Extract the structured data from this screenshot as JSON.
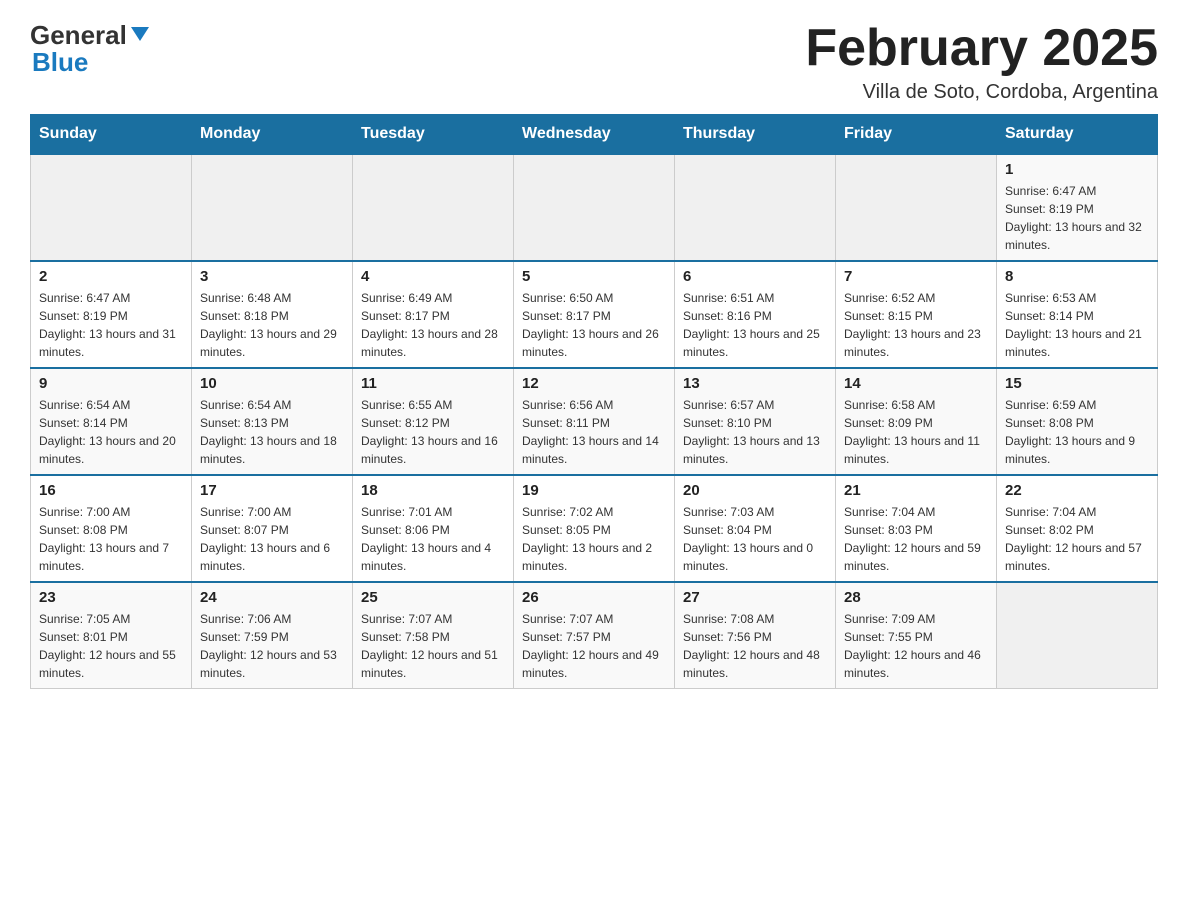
{
  "header": {
    "logo_main": "General",
    "logo_accent": "Blue",
    "month_title": "February 2025",
    "location": "Villa de Soto, Cordoba, Argentina"
  },
  "days_of_week": [
    "Sunday",
    "Monday",
    "Tuesday",
    "Wednesday",
    "Thursday",
    "Friday",
    "Saturday"
  ],
  "weeks": [
    [
      {
        "day": "",
        "info": ""
      },
      {
        "day": "",
        "info": ""
      },
      {
        "day": "",
        "info": ""
      },
      {
        "day": "",
        "info": ""
      },
      {
        "day": "",
        "info": ""
      },
      {
        "day": "",
        "info": ""
      },
      {
        "day": "1",
        "info": "Sunrise: 6:47 AM\nSunset: 8:19 PM\nDaylight: 13 hours and 32 minutes."
      }
    ],
    [
      {
        "day": "2",
        "info": "Sunrise: 6:47 AM\nSunset: 8:19 PM\nDaylight: 13 hours and 31 minutes."
      },
      {
        "day": "3",
        "info": "Sunrise: 6:48 AM\nSunset: 8:18 PM\nDaylight: 13 hours and 29 minutes."
      },
      {
        "day": "4",
        "info": "Sunrise: 6:49 AM\nSunset: 8:17 PM\nDaylight: 13 hours and 28 minutes."
      },
      {
        "day": "5",
        "info": "Sunrise: 6:50 AM\nSunset: 8:17 PM\nDaylight: 13 hours and 26 minutes."
      },
      {
        "day": "6",
        "info": "Sunrise: 6:51 AM\nSunset: 8:16 PM\nDaylight: 13 hours and 25 minutes."
      },
      {
        "day": "7",
        "info": "Sunrise: 6:52 AM\nSunset: 8:15 PM\nDaylight: 13 hours and 23 minutes."
      },
      {
        "day": "8",
        "info": "Sunrise: 6:53 AM\nSunset: 8:14 PM\nDaylight: 13 hours and 21 minutes."
      }
    ],
    [
      {
        "day": "9",
        "info": "Sunrise: 6:54 AM\nSunset: 8:14 PM\nDaylight: 13 hours and 20 minutes."
      },
      {
        "day": "10",
        "info": "Sunrise: 6:54 AM\nSunset: 8:13 PM\nDaylight: 13 hours and 18 minutes."
      },
      {
        "day": "11",
        "info": "Sunrise: 6:55 AM\nSunset: 8:12 PM\nDaylight: 13 hours and 16 minutes."
      },
      {
        "day": "12",
        "info": "Sunrise: 6:56 AM\nSunset: 8:11 PM\nDaylight: 13 hours and 14 minutes."
      },
      {
        "day": "13",
        "info": "Sunrise: 6:57 AM\nSunset: 8:10 PM\nDaylight: 13 hours and 13 minutes."
      },
      {
        "day": "14",
        "info": "Sunrise: 6:58 AM\nSunset: 8:09 PM\nDaylight: 13 hours and 11 minutes."
      },
      {
        "day": "15",
        "info": "Sunrise: 6:59 AM\nSunset: 8:08 PM\nDaylight: 13 hours and 9 minutes."
      }
    ],
    [
      {
        "day": "16",
        "info": "Sunrise: 7:00 AM\nSunset: 8:08 PM\nDaylight: 13 hours and 7 minutes."
      },
      {
        "day": "17",
        "info": "Sunrise: 7:00 AM\nSunset: 8:07 PM\nDaylight: 13 hours and 6 minutes."
      },
      {
        "day": "18",
        "info": "Sunrise: 7:01 AM\nSunset: 8:06 PM\nDaylight: 13 hours and 4 minutes."
      },
      {
        "day": "19",
        "info": "Sunrise: 7:02 AM\nSunset: 8:05 PM\nDaylight: 13 hours and 2 minutes."
      },
      {
        "day": "20",
        "info": "Sunrise: 7:03 AM\nSunset: 8:04 PM\nDaylight: 13 hours and 0 minutes."
      },
      {
        "day": "21",
        "info": "Sunrise: 7:04 AM\nSunset: 8:03 PM\nDaylight: 12 hours and 59 minutes."
      },
      {
        "day": "22",
        "info": "Sunrise: 7:04 AM\nSunset: 8:02 PM\nDaylight: 12 hours and 57 minutes."
      }
    ],
    [
      {
        "day": "23",
        "info": "Sunrise: 7:05 AM\nSunset: 8:01 PM\nDaylight: 12 hours and 55 minutes."
      },
      {
        "day": "24",
        "info": "Sunrise: 7:06 AM\nSunset: 7:59 PM\nDaylight: 12 hours and 53 minutes."
      },
      {
        "day": "25",
        "info": "Sunrise: 7:07 AM\nSunset: 7:58 PM\nDaylight: 12 hours and 51 minutes."
      },
      {
        "day": "26",
        "info": "Sunrise: 7:07 AM\nSunset: 7:57 PM\nDaylight: 12 hours and 49 minutes."
      },
      {
        "day": "27",
        "info": "Sunrise: 7:08 AM\nSunset: 7:56 PM\nDaylight: 12 hours and 48 minutes."
      },
      {
        "day": "28",
        "info": "Sunrise: 7:09 AM\nSunset: 7:55 PM\nDaylight: 12 hours and 46 minutes."
      },
      {
        "day": "",
        "info": ""
      }
    ]
  ]
}
